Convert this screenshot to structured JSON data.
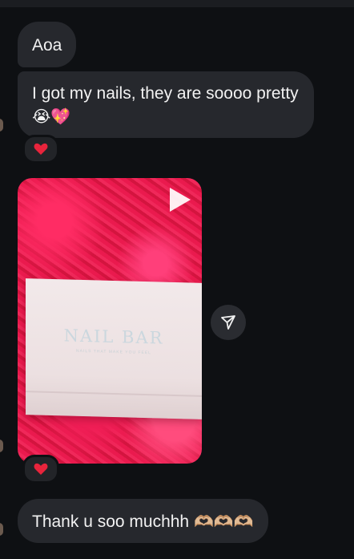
{
  "messages": {
    "greeting": "Aoa",
    "nails_text": "I got my nails, they are soooo pretty",
    "nails_emojis": "😭💖",
    "thanks_text": "Thank u soo muchhh",
    "thanks_emojis": "🫶🏼🫶🏼🫶🏼"
  },
  "reactions": {
    "first": "❤️",
    "second": "❤️"
  },
  "video": {
    "box_brand": "NAIL BAR",
    "box_subtitle": "NAILS THAT MAKE YOU FEEL",
    "play_icon": "play-icon"
  },
  "icons": {
    "share": "share-send-icon"
  },
  "colors": {
    "background": "#0e1013",
    "bubble": "#26282d",
    "text": "#f2f2f2",
    "heart": "#e8243c",
    "video_bg": "#e01a4d"
  }
}
